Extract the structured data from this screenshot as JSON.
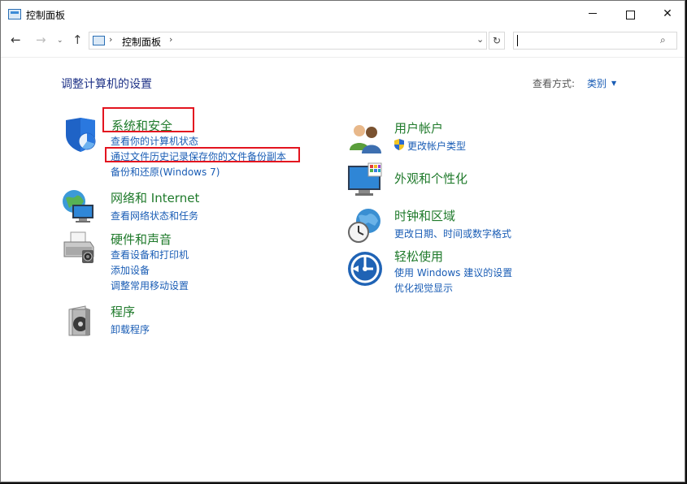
{
  "window": {
    "title": "控制面板",
    "buttons": {
      "minimize": "—",
      "maximize": "□",
      "close": "✕"
    }
  },
  "nav": {
    "back": "←",
    "forward": "→",
    "recent": "⌄",
    "up": "↑",
    "address_sep": "›",
    "address_path": "控制面板",
    "address_sep2": "›",
    "address_dropdown": "⌄",
    "refresh": "↻",
    "search_placeholder": "",
    "search_icon": "⌕"
  },
  "header": {
    "title": "调整计算机的设置",
    "view_label": "查看方式:",
    "view_value": "类别"
  },
  "categories_left": [
    {
      "title": "系统和安全",
      "icon": "shield-icon",
      "links": [
        "查看你的计算机状态",
        "通过文件历史记录保存你的文件备份副本",
        "备份和还原(Windows 7)"
      ]
    },
    {
      "title": "网络和 Internet",
      "icon": "network-globe-icon",
      "links": [
        "查看网络状态和任务"
      ]
    },
    {
      "title": "硬件和声音",
      "icon": "printer-icon",
      "links": [
        "查看设备和打印机",
        "添加设备",
        "调整常用移动设置"
      ]
    },
    {
      "title": "程序",
      "icon": "programs-disc-icon",
      "links": [
        "卸载程序"
      ]
    }
  ],
  "categories_right": [
    {
      "title": "用户帐户",
      "icon": "users-icon",
      "links": [
        "更改帐户类型"
      ]
    },
    {
      "title": "外观和个性化",
      "icon": "monitor-palette-icon",
      "links": []
    },
    {
      "title": "时钟和区域",
      "icon": "clock-globe-icon",
      "links": [
        "更改日期、时间或数字格式"
      ]
    },
    {
      "title": "轻松使用",
      "icon": "accessibility-icon",
      "links": [
        "使用 Windows 建议的设置",
        "优化视觉显示"
      ]
    }
  ],
  "colors": {
    "category_title": "#1f7a2b",
    "link": "#1a5db5",
    "page_title": "#1e3287",
    "highlight": "#e3141f"
  }
}
